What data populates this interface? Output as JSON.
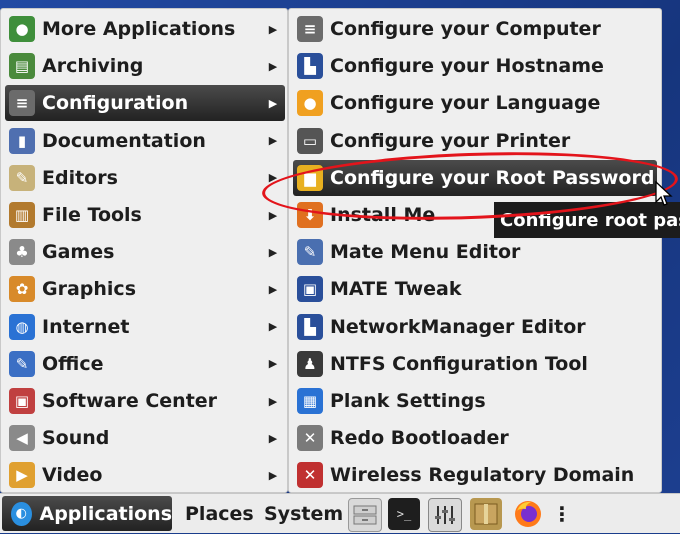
{
  "menu_left": {
    "items": [
      {
        "label": "More Applications",
        "icon": "apps-icon",
        "color": "#3f8f3b",
        "glyph": "●"
      },
      {
        "label": "Archiving",
        "icon": "archive-icon",
        "color": "#4a8a3c",
        "glyph": "▤"
      },
      {
        "label": "Configuration",
        "icon": "sliders-icon",
        "color": "#6b6b6b",
        "glyph": "≡",
        "selected": true
      },
      {
        "label": "Documentation",
        "icon": "book-icon",
        "color": "#4f6fb0",
        "glyph": "▮"
      },
      {
        "label": "Editors",
        "icon": "notepad-icon",
        "color": "#c7b27a",
        "glyph": "✎"
      },
      {
        "label": "File Tools",
        "icon": "file-cabinet-icon",
        "color": "#b27a2e",
        "glyph": "▥"
      },
      {
        "label": "Games",
        "icon": "joystick-icon",
        "color": "#8a8a8a",
        "glyph": "♣"
      },
      {
        "label": "Graphics",
        "icon": "palette-icon",
        "color": "#d88a2a",
        "glyph": "✿"
      },
      {
        "label": "Internet",
        "icon": "globe-icon",
        "color": "#2a72d4",
        "glyph": "◍"
      },
      {
        "label": "Office",
        "icon": "office-icon",
        "color": "#3b6fc4",
        "glyph": "✎"
      },
      {
        "label": "Software Center",
        "icon": "software-center-icon",
        "color": "#c04040",
        "glyph": "▣"
      },
      {
        "label": "Sound",
        "icon": "speaker-icon",
        "color": "#8a8a8a",
        "glyph": "◀"
      },
      {
        "label": "Video",
        "icon": "video-icon",
        "color": "#e0a030",
        "glyph": "▶"
      }
    ]
  },
  "menu_right": {
    "items": [
      {
        "label": "Configure your Computer",
        "icon": "sliders-icon",
        "color": "#6b6b6b",
        "glyph": "≡"
      },
      {
        "label": "Configure your Hostname",
        "icon": "network-icon",
        "color": "#2a4f9a",
        "glyph": "▙"
      },
      {
        "label": "Configure your Language",
        "icon": "location-pin-icon",
        "color": "#f0a020",
        "glyph": "●"
      },
      {
        "label": "Configure your Printer",
        "icon": "printer-icon",
        "color": "#555555",
        "glyph": "▭"
      },
      {
        "label": "Configure your Root Password",
        "icon": "lock-icon",
        "color": "#e8b020",
        "glyph": "▆",
        "selected": true
      },
      {
        "label": "Install Me",
        "icon": "install-icon",
        "color": "#e07020",
        "glyph": "⬇"
      },
      {
        "label": "Mate Menu Editor",
        "icon": "menu-editor-icon",
        "color": "#4a6fb0",
        "glyph": "✎"
      },
      {
        "label": "MATE Tweak",
        "icon": "monitor-icon",
        "color": "#2a4f9a",
        "glyph": "▣"
      },
      {
        "label": "NetworkManager Editor",
        "icon": "network-icon",
        "color": "#2a4f9a",
        "glyph": "▙"
      },
      {
        "label": "NTFS Configuration Tool",
        "icon": "penguin-icon",
        "color": "#3a3a3a",
        "glyph": "♟"
      },
      {
        "label": "Plank Settings",
        "icon": "plank-icon",
        "color": "#2a72d4",
        "glyph": "▦"
      },
      {
        "label": "Redo Bootloader",
        "icon": "tools-icon",
        "color": "#7a7a7a",
        "glyph": "✕"
      },
      {
        "label": "Wireless Regulatory Domain",
        "icon": "wrench-icon",
        "color": "#c03030",
        "glyph": "✕"
      }
    ]
  },
  "tooltip": {
    "text": "Configure root password"
  },
  "taskbar": {
    "applications": "Applications",
    "places": "Places",
    "system": "System",
    "more": "⋮"
  }
}
